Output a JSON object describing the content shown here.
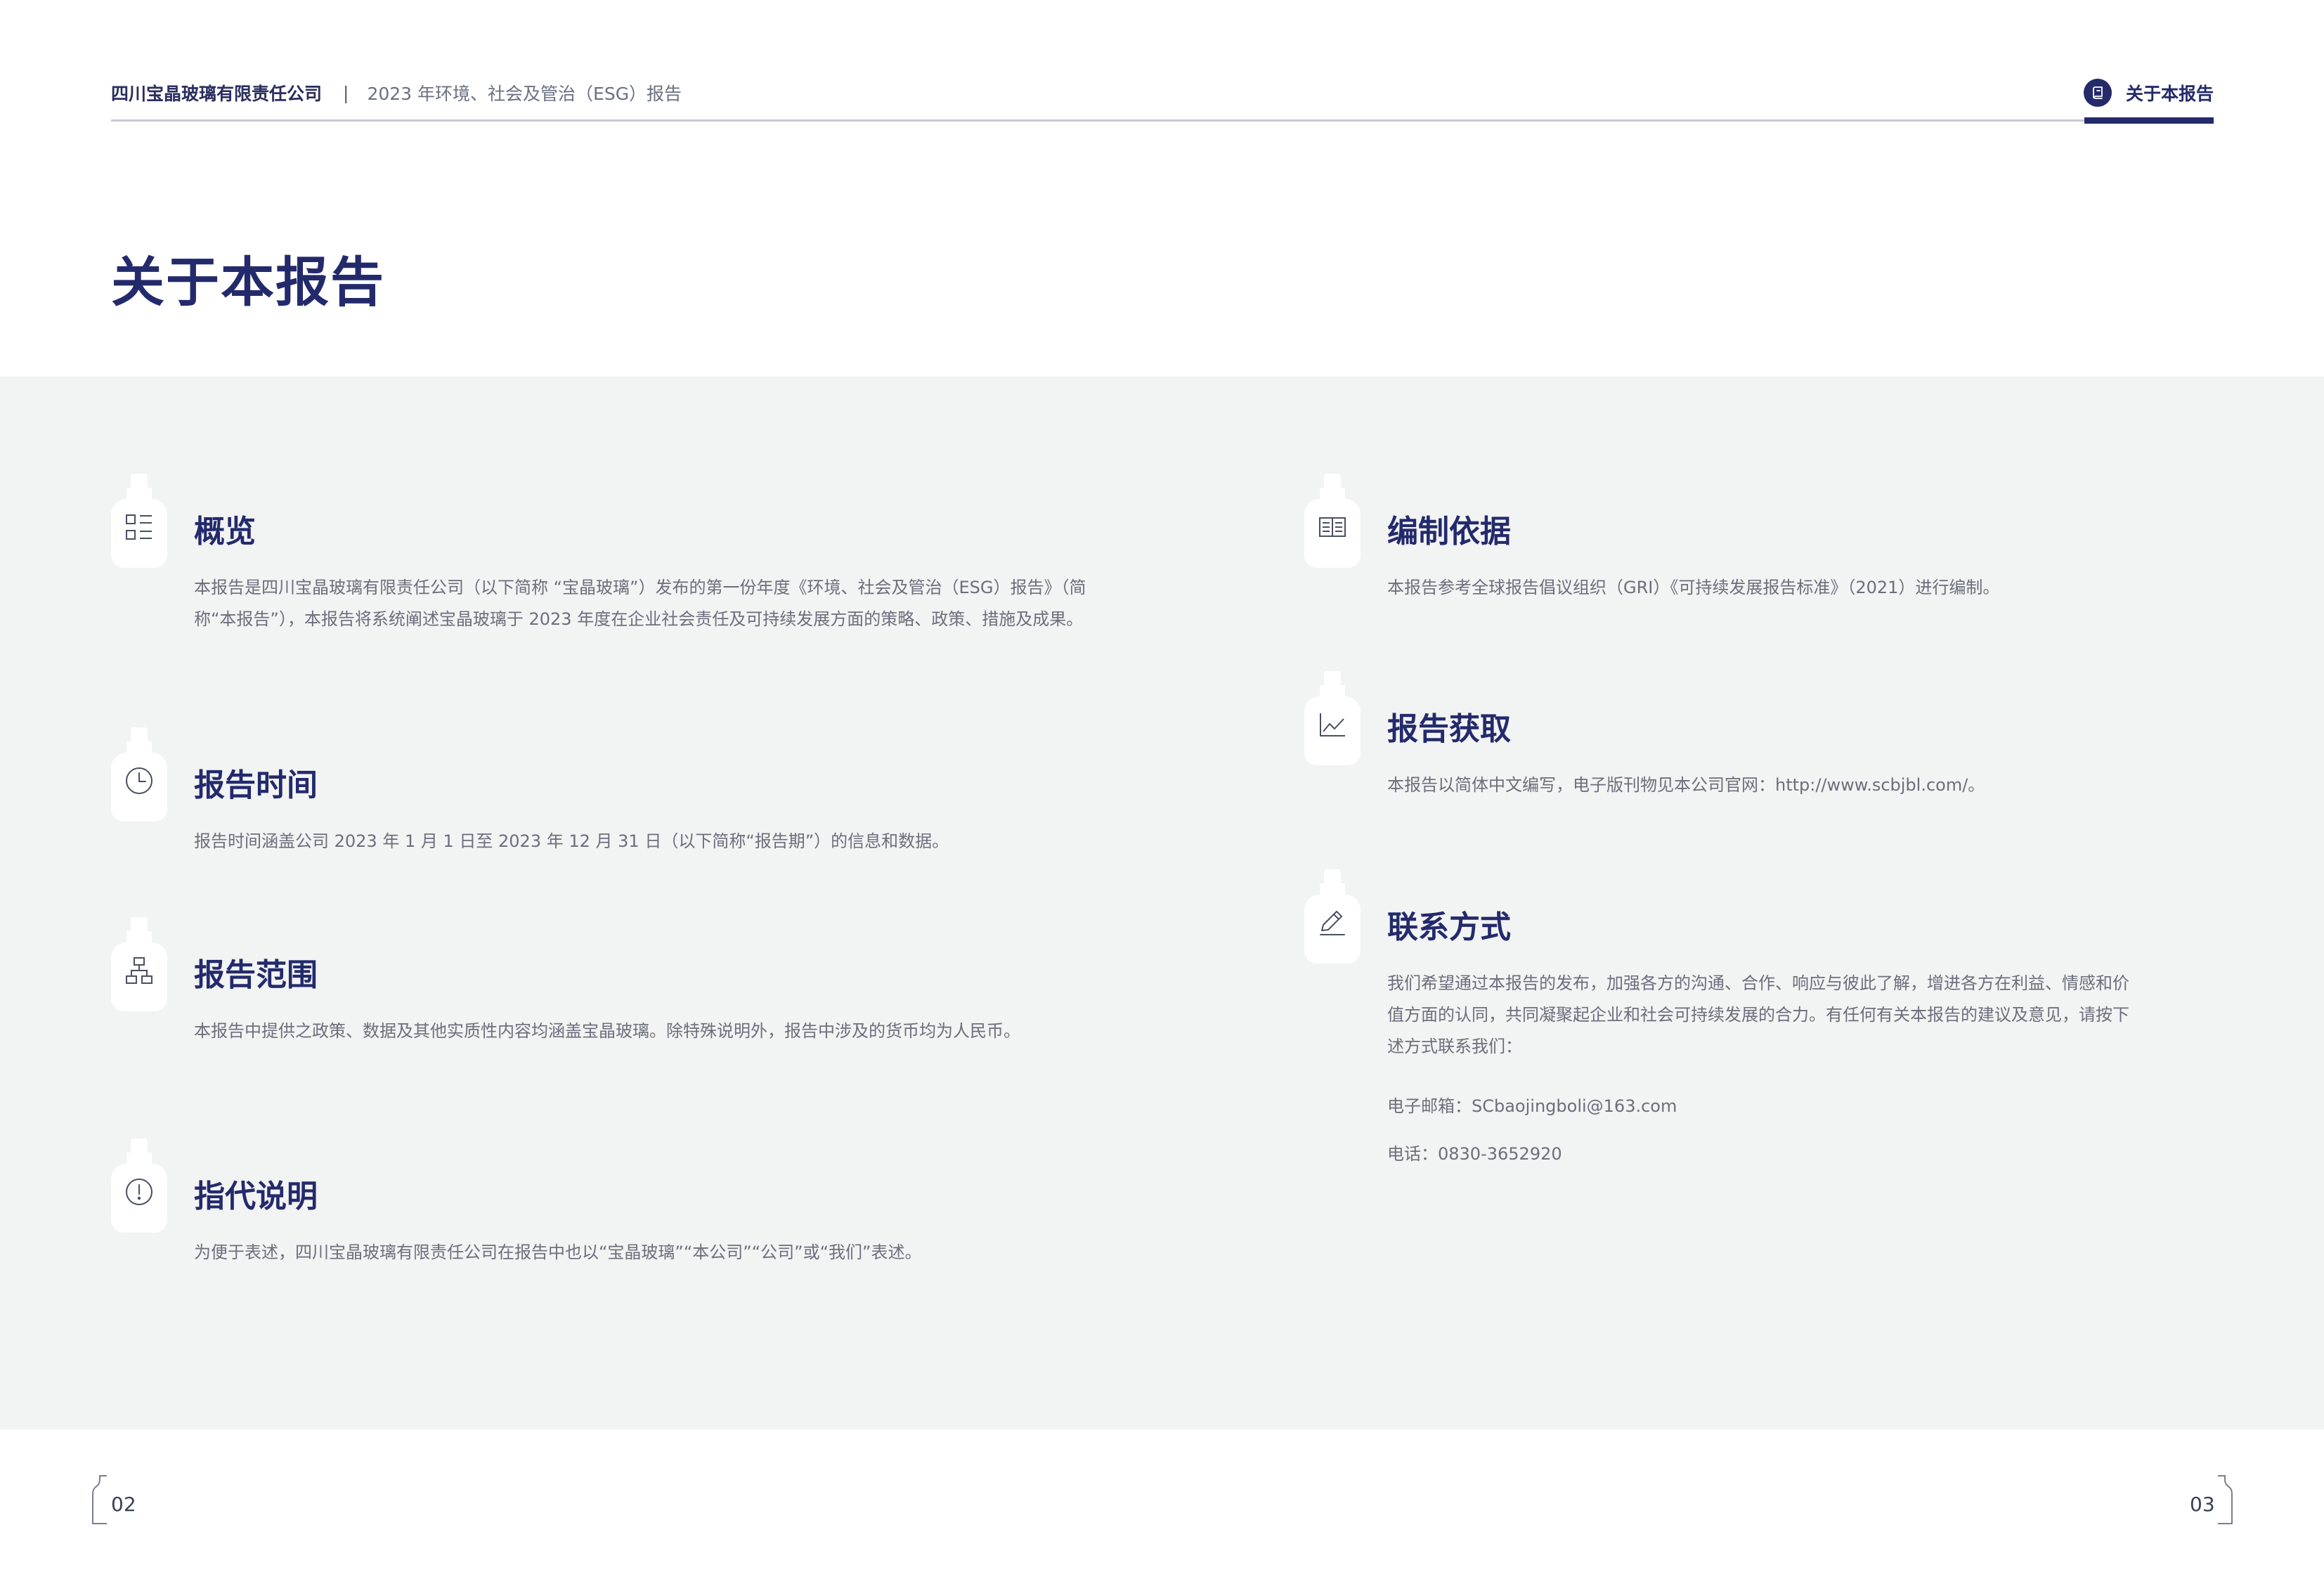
{
  "header": {
    "company": "四川宝晶玻璃有限责任公司",
    "separator": "|",
    "report_name": "2023 年环境、社会及管治（ESG）报告",
    "nav_label": "关于本报告",
    "nav_icon": "book-icon"
  },
  "page_title": "关于本报告",
  "sections": {
    "overview": {
      "icon": "list-icon",
      "title": "概览",
      "body": "本报告是四川宝晶玻璃有限责任公司（以下简称 “宝晶玻璃”）发布的第一份年度《环境、社会及管治（ESG）报告》（简称“本报告”），本报告将系统阐述宝晶玻璃于 2023 年度在企业社会责任及可持续发展方面的策略、政策、措施及成果。"
    },
    "period": {
      "icon": "clock-icon",
      "title": "报告时间",
      "body": "报告时间涵盖公司 2023 年 1 月 1 日至 2023 年 12 月 31 日（以下简称“报告期”）的信息和数据。"
    },
    "scope": {
      "icon": "org-chart-icon",
      "title": "报告范围",
      "body": "本报告中提供之政策、数据及其他实质性内容均涵盖宝晶玻璃。除特殊说明外，报告中涉及的货币均为人民币。"
    },
    "reference": {
      "icon": "info-circle-icon",
      "title": "指代说明",
      "body": "为便于表述，四川宝晶玻璃有限责任公司在报告中也以“宝晶玻璃”“本公司”“公司”或“我们”表述。"
    },
    "basis": {
      "icon": "open-book-icon",
      "title": "编制依据",
      "body": "本报告参考全球报告倡议组织（GRI）《可持续发展报告标准》（2021）进行编制。"
    },
    "access": {
      "icon": "line-chart-icon",
      "title": "报告获取",
      "body": "本报告以简体中文编写，电子版刊物见本公司官网：http://www.scbjbl.com/。"
    },
    "contact": {
      "icon": "pen-icon",
      "title": "联系方式",
      "body": "我们希望通过本报告的发布，加强各方的沟通、合作、响应与彼此了解，增进各方在利益、情感和价值方面的认同，共同凝聚起企业和社会可持续发展的合力。有任何有关本报告的建议及意见，请按下述方式联系我们：",
      "email": "电子邮箱：SCbaojingboli@163.com",
      "phone": "电话：0830-3652920"
    }
  },
  "footer": {
    "page_left": "02",
    "page_right": "03"
  },
  "colors": {
    "brand_navy": "#232a6c",
    "band_grey": "#f2f3f3",
    "body_text": "#6b6f7b"
  }
}
